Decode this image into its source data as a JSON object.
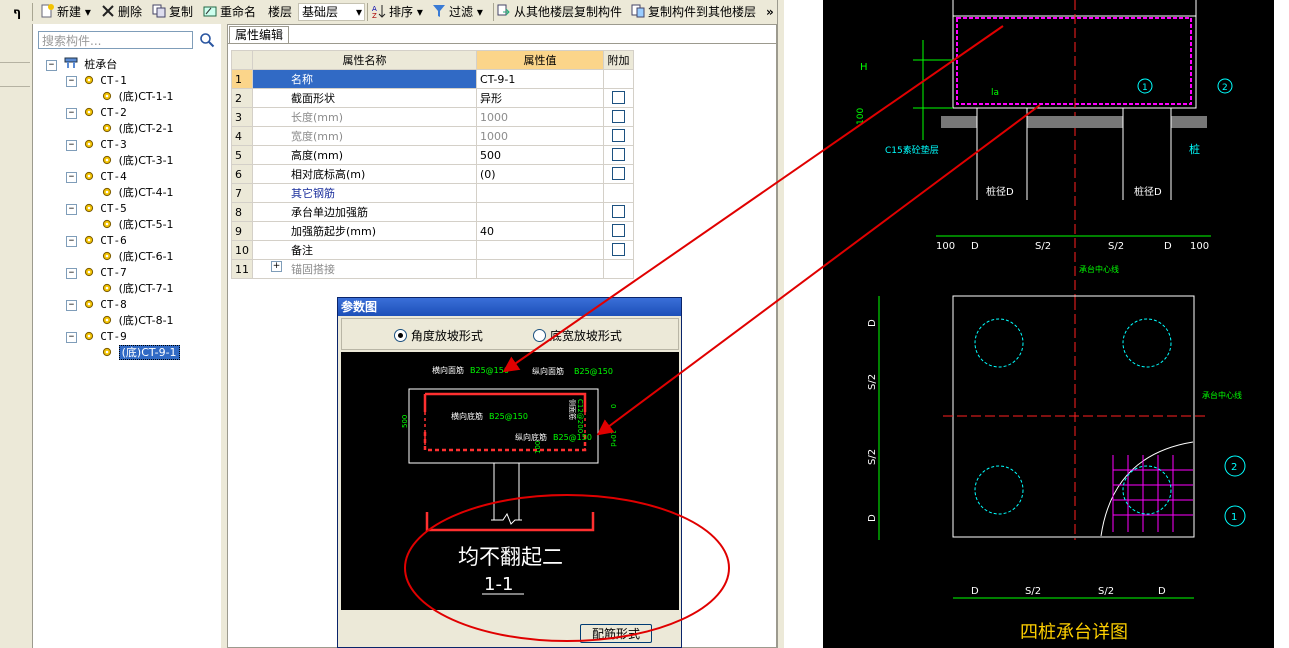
{
  "toolbar": {
    "pin": "ᅟP",
    "new": "新建",
    "delete": "删除",
    "copy": "复制",
    "rename": "重命名",
    "floor_label": "楼层",
    "floor_value": "基础层",
    "sort": "排序",
    "filter": "过滤",
    "copy_from_floor": "从其他楼层复制构件",
    "copy_to_floor": "复制构件到其他楼层",
    "more": "»"
  },
  "search": {
    "placeholder": "搜索构件..."
  },
  "tree": {
    "root": "桩承台",
    "items": [
      {
        "label": "CT-1",
        "child": "(底)CT-1-1"
      },
      {
        "label": "CT-2",
        "child": "(底)CT-2-1"
      },
      {
        "label": "CT-3",
        "child": "(底)CT-3-1"
      },
      {
        "label": "CT-4",
        "child": "(底)CT-4-1"
      },
      {
        "label": "CT-5",
        "child": "(底)CT-5-1"
      },
      {
        "label": "CT-6",
        "child": "(底)CT-6-1"
      },
      {
        "label": "CT-7",
        "child": "(底)CT-7-1"
      },
      {
        "label": "CT-8",
        "child": "(底)CT-8-1"
      },
      {
        "label": "CT-9",
        "child": "(底)CT-9-1"
      }
    ]
  },
  "props": {
    "tab": "属性编辑",
    "col_name": "属性名称",
    "col_value": "属性值",
    "col_extra": "附加",
    "rows": [
      {
        "n": "1",
        "name": "名称",
        "value": "CT-9-1"
      },
      {
        "n": "2",
        "name": "截面形状",
        "value": "异形"
      },
      {
        "n": "3",
        "name": "长度(mm)",
        "value": "1000"
      },
      {
        "n": "4",
        "name": "宽度(mm)",
        "value": "1000"
      },
      {
        "n": "5",
        "name": "高度(mm)",
        "value": "500"
      },
      {
        "n": "6",
        "name": "相对底标高(m)",
        "value": "(0)"
      },
      {
        "n": "7",
        "name": "其它钢筋",
        "value": ""
      },
      {
        "n": "8",
        "name": "承台单边加强筋",
        "value": ""
      },
      {
        "n": "9",
        "name": "加强筋起步(mm)",
        "value": "40"
      },
      {
        "n": "10",
        "name": "备注",
        "value": ""
      },
      {
        "n": "11",
        "name": "锚固搭接",
        "value": ""
      }
    ]
  },
  "dialog": {
    "title": "参数图",
    "opt1": "角度放坡形式",
    "opt2": "底宽放坡形式",
    "button": "配筋形式",
    "drawing": {
      "top_h": "横向面筋",
      "top_h_val": "B25@150",
      "top_v": "纵向面筋",
      "top_v_val": "B25@150",
      "bot_h": "横向底筋",
      "bot_h_val": "B25@150",
      "bot_v": "纵向底筋",
      "bot_v_val": "B25@150",
      "side": "侧面筋",
      "side_val": "C12@200",
      "h500": "500",
      "zero": "0",
      "d100": "100",
      "nd": "10*d",
      "caption": "均不翻起二",
      "section": "1-1"
    }
  },
  "cad": {
    "title": "四桩承台详图",
    "labels": {
      "H": "H",
      "d100a": "100",
      "la": "la",
      "c15": "C15素砼垫层",
      "pile": "桩",
      "pile_dia": "桩径D",
      "pile_dia2": "桩径D",
      "dims_top": [
        "100",
        "D",
        "S/2",
        "S/2",
        "D",
        "100"
      ],
      "center1": "承台中心线",
      "center2": "承台中心线",
      "left_dims": [
        "D",
        "S/2",
        "S/2",
        "D"
      ],
      "bottom_dims": [
        "D",
        "S/2",
        "S/2",
        "D"
      ],
      "mark1": "1",
      "mark2": "2",
      "mark1b": "1",
      "mark2b": "2"
    }
  },
  "colors": {
    "selection": "#316ac5",
    "value_header": "#fbd58a",
    "annotation": "#e00000",
    "cad_green": "#00ff00",
    "cad_cyan": "#00ffff"
  }
}
